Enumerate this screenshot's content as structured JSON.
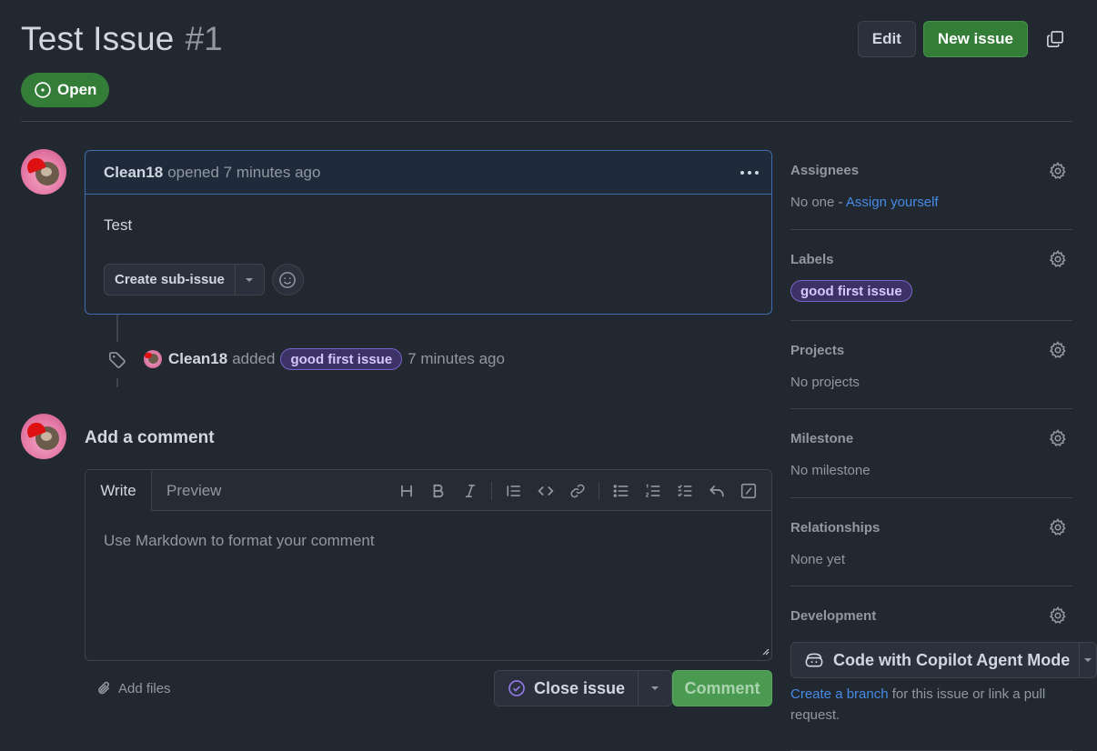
{
  "issue": {
    "title": "Test Issue",
    "number": "#1",
    "state": "Open"
  },
  "header": {
    "edit_label": "Edit",
    "new_issue_label": "New issue"
  },
  "comment": {
    "author": "Clean18",
    "meta": "opened 7 minutes ago",
    "body": "Test",
    "create_sub_issue_label": "Create sub-issue"
  },
  "timeline_event": {
    "author": "Clean18",
    "action": "added",
    "label": "good first issue",
    "time": "7 minutes ago"
  },
  "composer": {
    "title": "Add a comment",
    "tab_write": "Write",
    "tab_preview": "Preview",
    "placeholder": "Use Markdown to format your comment",
    "add_files_label": "Add files",
    "close_issue_label": "Close issue",
    "comment_label": "Comment"
  },
  "sidebar": {
    "assignees": {
      "heading": "Assignees",
      "value": "No one -",
      "link": "Assign yourself"
    },
    "labels": {
      "heading": "Labels",
      "items": [
        "good first issue"
      ]
    },
    "projects": {
      "heading": "Projects",
      "value": "No projects"
    },
    "milestone": {
      "heading": "Milestone",
      "value": "No milestone"
    },
    "relationships": {
      "heading": "Relationships",
      "value": "None yet"
    },
    "development": {
      "heading": "Development",
      "copilot_label": "Code with Copilot Agent Mode",
      "link": "Create a branch",
      "text": "for this issue or link a pull request."
    }
  },
  "colors": {
    "background": "#212830",
    "open_green": "#347d39",
    "link_blue": "#478be6",
    "label_purple": "#7764c8"
  }
}
